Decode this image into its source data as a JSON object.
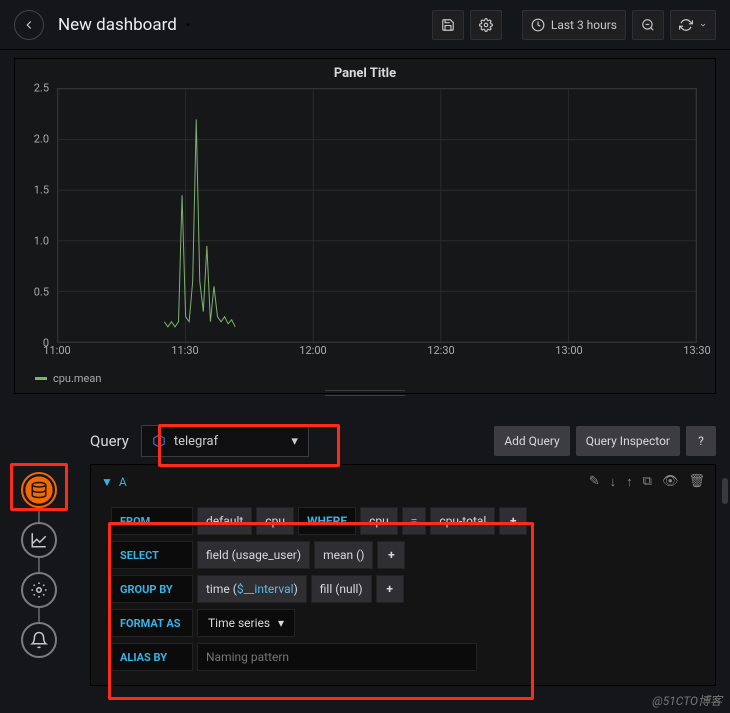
{
  "header": {
    "title": "New dashboard",
    "time_range": "Last 3 hours"
  },
  "panel": {
    "title": "Panel Title",
    "legend": "cpu.mean"
  },
  "chart_data": {
    "type": "line",
    "title": "Panel Title",
    "xlabel": "",
    "ylabel": "",
    "ylim": [
      0,
      2.5
    ],
    "y_ticks": [
      0,
      0.5,
      1.0,
      1.5,
      2.0,
      2.5
    ],
    "x_ticks": [
      "11:00",
      "11:30",
      "12:00",
      "12:30",
      "13:00",
      "13:30"
    ],
    "x_range_minutes": [
      660,
      840
    ],
    "series": [
      {
        "name": "cpu.mean",
        "color": "#7eb26d",
        "points": [
          [
            690,
            0.2
          ],
          [
            691,
            0.15
          ],
          [
            692,
            0.2
          ],
          [
            693,
            0.15
          ],
          [
            694,
            0.2
          ],
          [
            695,
            1.45
          ],
          [
            696,
            0.25
          ],
          [
            697,
            0.2
          ],
          [
            698,
            0.6
          ],
          [
            699,
            2.2
          ],
          [
            700,
            0.6
          ],
          [
            701,
            0.3
          ],
          [
            702,
            0.95
          ],
          [
            703,
            0.2
          ],
          [
            704,
            0.55
          ],
          [
            705,
            0.25
          ],
          [
            706,
            0.2
          ],
          [
            707,
            0.25
          ],
          [
            708,
            0.18
          ],
          [
            709,
            0.22
          ],
          [
            710,
            0.15
          ]
        ]
      }
    ]
  },
  "query_editor": {
    "section_title": "Query",
    "datasource": "telegraf",
    "add_query_label": "Add Query",
    "inspector_label": "Query Inspector",
    "help_label": "?",
    "query_letter": "A",
    "rows": {
      "from_kw": "FROM",
      "from_policy": "default",
      "from_measurement": "cpu",
      "where_kw": "WHERE",
      "where_tag": "cpu",
      "where_op": "=",
      "where_val": "cpu-total",
      "select_kw": "SELECT",
      "select_field": "field (usage_user)",
      "select_agg": "mean ()",
      "group_kw": "GROUP BY",
      "group_time_prefix": "time (",
      "group_time_var": "$__interval",
      "group_time_suffix": ")",
      "group_fill": "fill (null)",
      "format_kw": "FORMAT AS",
      "format_val": "Time series",
      "alias_kw": "ALIAS BY",
      "alias_placeholder": "Naming pattern",
      "plus": "+"
    }
  },
  "watermark": "@51CTO博客"
}
